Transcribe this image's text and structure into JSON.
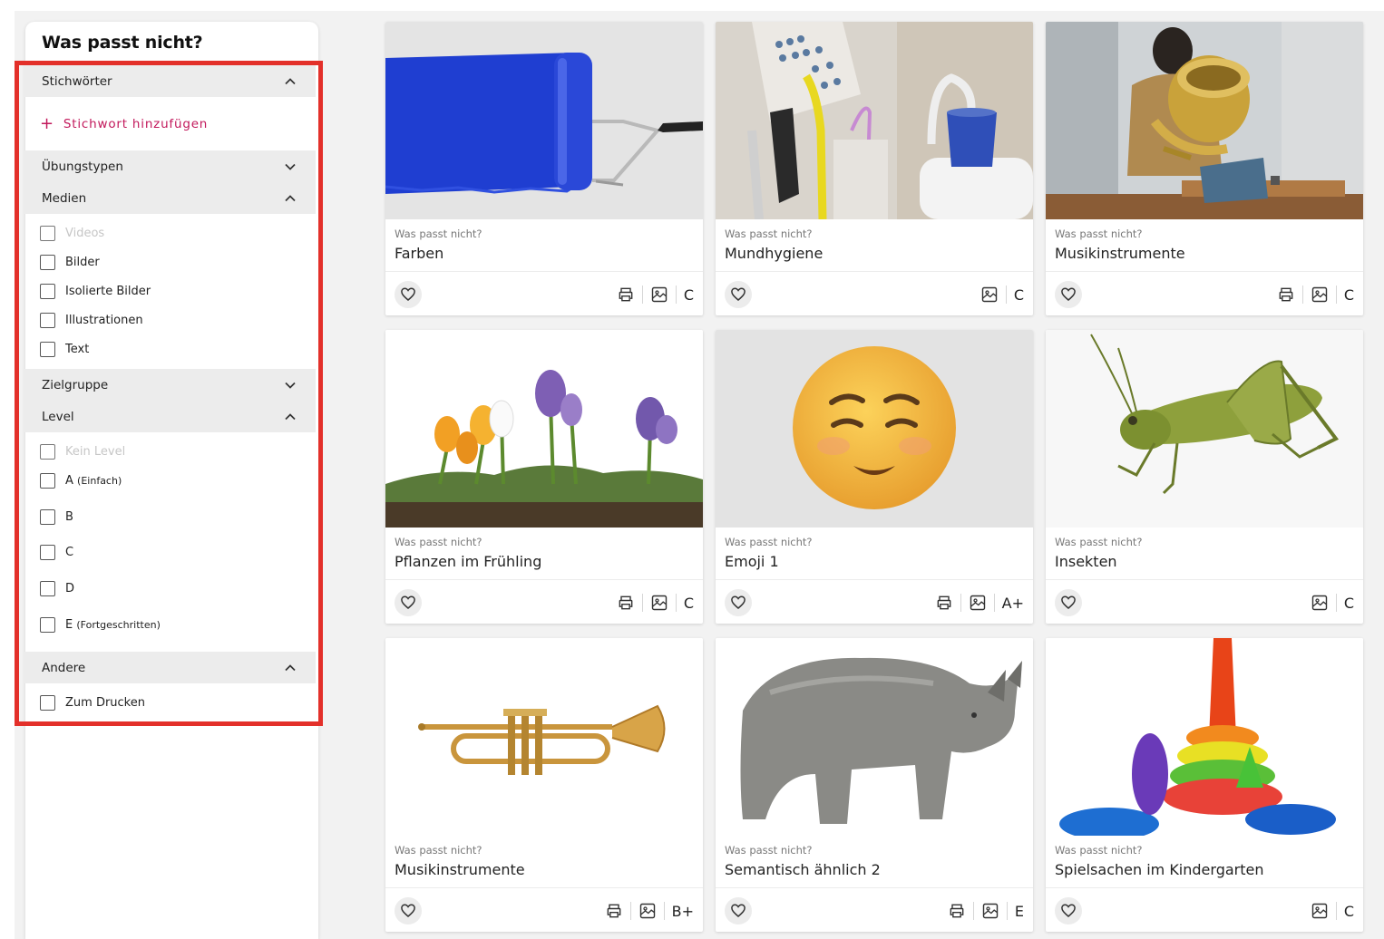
{
  "sidebar": {
    "title": "Was passt nicht?",
    "sections": {
      "keywords": {
        "label": "Stichwörter",
        "add_label": "Stichwort hinzufügen"
      },
      "exercise_types": {
        "label": "Übungstypen"
      },
      "media": {
        "label": "Medien",
        "options": [
          "Videos",
          "Bilder",
          "Isolierte Bilder",
          "Illustrationen",
          "Text"
        ]
      },
      "audience": {
        "label": "Zielgruppe"
      },
      "level": {
        "label": "Level",
        "options": [
          {
            "main": "Kein Level",
            "sub": ""
          },
          {
            "main": "A",
            "sub": "(Einfach)"
          },
          {
            "main": "B",
            "sub": ""
          },
          {
            "main": "C",
            "sub": ""
          },
          {
            "main": "D",
            "sub": ""
          },
          {
            "main": "E",
            "sub": "(Fortgeschritten)"
          }
        ]
      },
      "other": {
        "label": "Andere",
        "options": [
          "Zum Drucken"
        ]
      }
    }
  },
  "colors": {
    "accent": "#c2185b",
    "highlight": "#e3302a",
    "section_bg": "#ececec"
  },
  "cards": [
    {
      "type": "Was passt nicht?",
      "title": "Farben",
      "level": "C",
      "printable": true,
      "image": "paint-roller"
    },
    {
      "type": "Was passt nicht?",
      "title": "Mundhygiene",
      "level": "C",
      "printable": false,
      "image": "dental-unit"
    },
    {
      "type": "Was passt nicht?",
      "title": "Musikinstrumente",
      "level": "C",
      "printable": true,
      "image": "tuba-player"
    },
    {
      "type": "Was passt nicht?",
      "title": "Pflanzen im Frühling",
      "level": "C",
      "printable": true,
      "image": "crocus-flowers"
    },
    {
      "type": "Was passt nicht?",
      "title": "Emoji 1",
      "level": "A+",
      "printable": true,
      "image": "smiling-emoji"
    },
    {
      "type": "Was passt nicht?",
      "title": "Insekten",
      "level": "C",
      "printable": false,
      "image": "grasshopper"
    },
    {
      "type": "Was passt nicht?",
      "title": "Musikinstrumente",
      "level": "B+",
      "printable": true,
      "image": "trumpet"
    },
    {
      "type": "Was passt nicht?",
      "title": "Semantisch ähnlich 2",
      "level": "E",
      "printable": true,
      "image": "rhinoceros"
    },
    {
      "type": "Was passt nicht?",
      "title": "Spielsachen im Kindergarten",
      "level": "C",
      "printable": false,
      "image": "stacking-rings"
    }
  ]
}
